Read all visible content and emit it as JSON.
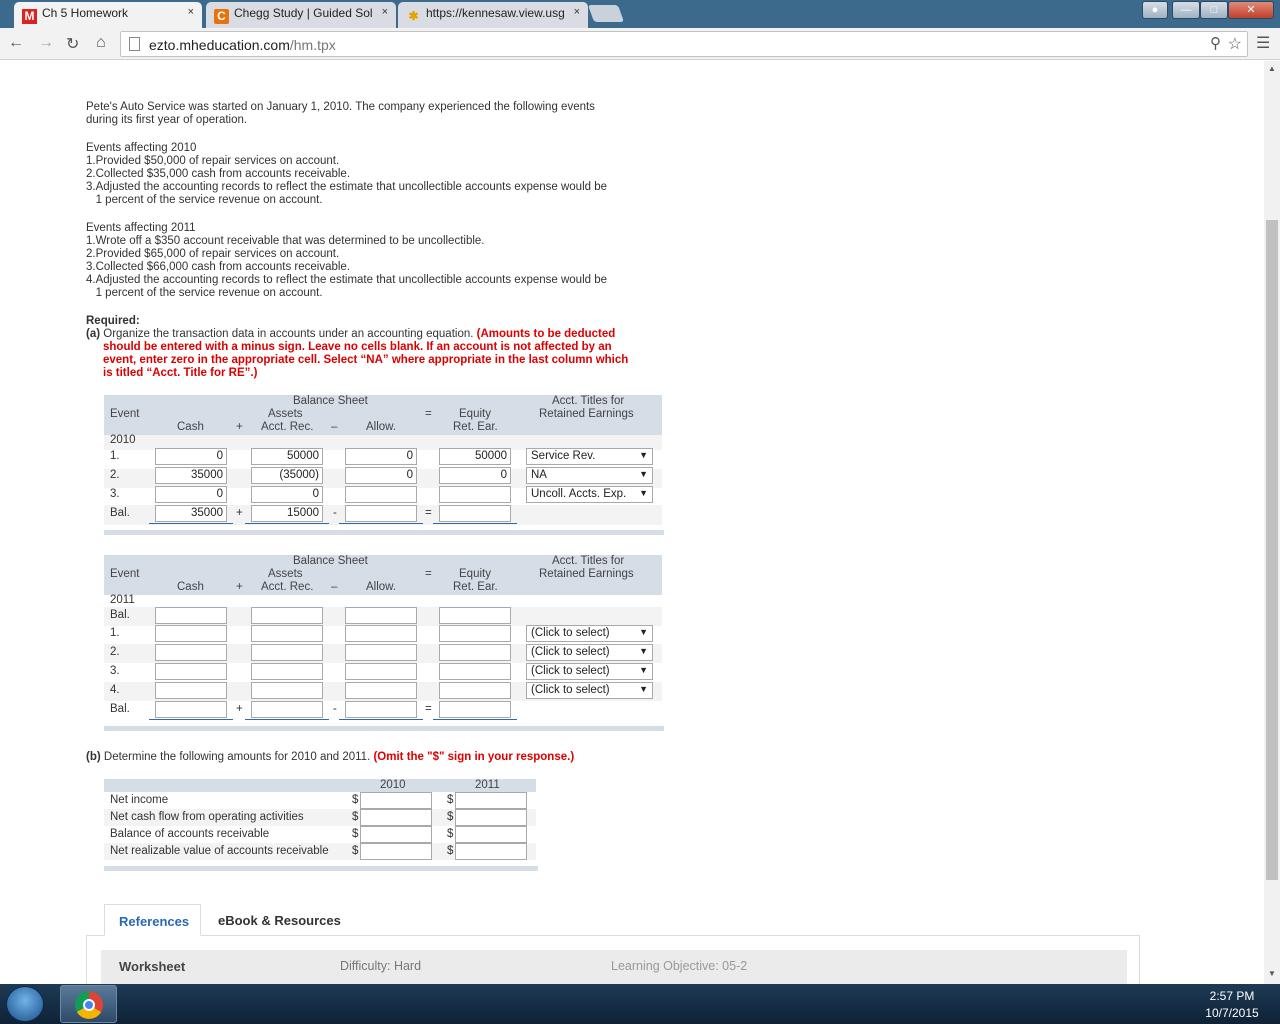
{
  "browser": {
    "tabs": [
      {
        "icon": "M",
        "title": "Ch 5 Homework",
        "active": true
      },
      {
        "icon": "C",
        "title": "Chegg Study | Guided Sol",
        "active": false
      },
      {
        "icon": "✱",
        "title": "https://kennesaw.view.usg",
        "active": false
      }
    ],
    "close_glyph": "×",
    "url_host": "ezto.mheducation.com",
    "url_path": "/hm.tpx"
  },
  "problem": {
    "intro_1": "Pete's Auto Service was started on January 1, 2010. The company experienced the following events",
    "intro_2": "during its first year of operation.",
    "events_2010_title": "Events affecting 2010",
    "events_2010": [
      "1.Provided $50,000 of repair services on account.",
      "2.Collected $35,000 cash from accounts receivable.",
      "3.Adjusted the accounting records to reflect the estimate that uncollectible accounts expense would be",
      "   1 percent of the service revenue on account."
    ],
    "events_2011_title": "Events affecting 2011",
    "events_2011": [
      "1.Wrote off a $350 account receivable that was determined to be uncollectible.",
      "2.Provided $65,000 of repair services on account.",
      "3.Collected $66,000 cash from accounts receivable.",
      "4.Adjusted the accounting records to reflect the estimate that uncollectible accounts expense would be",
      "   1 percent of the service revenue on account."
    ],
    "required_label": "Required:",
    "part_a_label": "(a)",
    "part_a_text": "Organize the transaction data in accounts under an accounting equation.",
    "part_a_note_1": "(Amounts to be deducted",
    "part_a_note_2": "should be entered with a minus sign. Leave no cells blank. If an account is not affected by an",
    "part_a_note_3": "event, enter zero in the appropriate cell. Select “NA” where appropriate in the last column which",
    "part_a_note_4": "is titled “Acct. Title for RE”.)"
  },
  "table_header": {
    "balance_sheet": "Balance Sheet",
    "assets": "Assets",
    "event": "Event",
    "cash": "Cash",
    "plus": "+",
    "acct_rec": "Acct. Rec.",
    "minus": "–",
    "allow": "Allow.",
    "equals": "=",
    "equity": "Equity",
    "ret_ear": "Ret. Ear.",
    "acct_titles_1": "Acct. Titles for",
    "acct_titles_2": "Retained Earnings"
  },
  "table_2010": {
    "year": "2010",
    "rows": [
      {
        "event": "1.",
        "cash": "0",
        "acct_rec": "50000",
        "allow": "0",
        "ret_ear": "50000",
        "title": "Service Rev."
      },
      {
        "event": "2.",
        "cash": "35000",
        "acct_rec": "(35000)",
        "allow": "0",
        "ret_ear": "0",
        "title": "NA"
      },
      {
        "event": "3.",
        "cash": "0",
        "acct_rec": "0",
        "allow": "",
        "ret_ear": "",
        "title": "Uncoll. Accts. Exp."
      }
    ],
    "bal": {
      "event": "Bal.",
      "cash": "35000",
      "acct_rec": "15000",
      "allow": "",
      "ret_ear": ""
    },
    "op_plus": "+",
    "op_minus": "-",
    "op_eq": "="
  },
  "table_2011": {
    "year": "2011",
    "bal_start": "Bal.",
    "rows": [
      {
        "event": "1.",
        "title": "(Click to select)"
      },
      {
        "event": "2.",
        "title": "(Click to select)"
      },
      {
        "event": "3.",
        "title": "(Click to select)"
      },
      {
        "event": "4.",
        "title": "(Click to select)"
      }
    ],
    "bal_end": "Bal.",
    "op_plus": "+",
    "op_minus": "-",
    "op_eq": "="
  },
  "part_b": {
    "label": "(b)",
    "text": "Determine the following amounts for 2010 and 2011.",
    "note": "(Omit the \"$\" sign in your response.)",
    "col_2010": "2010",
    "col_2011": "2011",
    "currency": "$",
    "rows": [
      "Net income",
      "Net cash flow from operating activities",
      "Balance of accounts receivable",
      "Net realizable value of accounts receivable"
    ]
  },
  "footer_tabs": {
    "references": "References",
    "ebook": "eBook & Resources"
  },
  "worksheet_bar": {
    "worksheet": "Worksheet",
    "difficulty": "Difficulty: Hard",
    "objective": "Learning Objective: 05-2"
  },
  "taskbar": {
    "time": "2:57 PM",
    "date": "10/7/2015"
  }
}
